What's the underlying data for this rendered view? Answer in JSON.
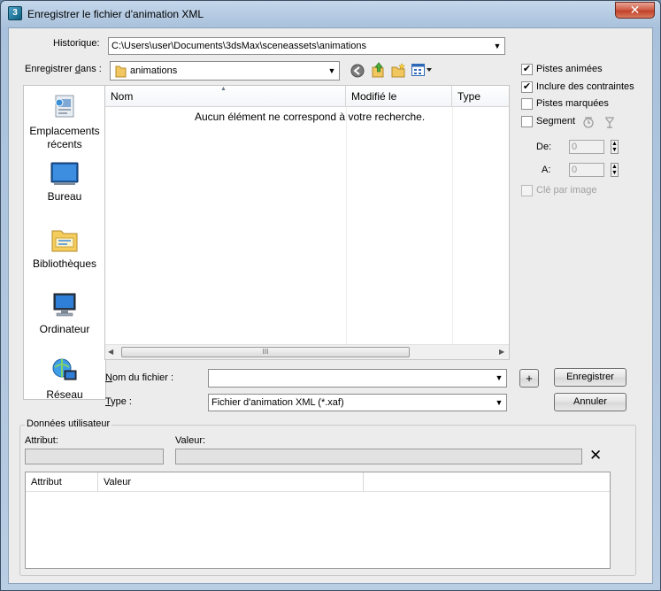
{
  "window": {
    "title": "Enregistrer le fichier d'animation XML",
    "close_symbol": "✕",
    "app_icon_symbol": "3"
  },
  "history": {
    "label": "Historique:",
    "value": "C:\\Users\\user\\Documents\\3dsMax\\sceneassets\\animations"
  },
  "save_in": {
    "label_pre": "Enregistrer ",
    "label_ul": "d",
    "label_post": "ans :",
    "value": "animations"
  },
  "places": [
    {
      "name": "recent",
      "label": "Emplacements récents"
    },
    {
      "name": "desktop",
      "label": "Bureau"
    },
    {
      "name": "libraries",
      "label": "Bibliothèques"
    },
    {
      "name": "computer",
      "label": "Ordinateur"
    },
    {
      "name": "network",
      "label": "Réseau"
    }
  ],
  "filelist": {
    "columns": [
      "Nom",
      "Modifié le",
      "Type"
    ],
    "empty_message": "Aucun élément ne correspond à votre recherche.",
    "scroll_grip": "III"
  },
  "filename": {
    "label_ul": "N",
    "label_post": "om du fichier :",
    "value": ""
  },
  "type": {
    "label_ul": "T",
    "label_post": "ype :",
    "value": "Fichier d'animation XML (*.xaf)"
  },
  "buttons": {
    "plus": "+",
    "save": "Enregistrer",
    "cancel": "Annuler"
  },
  "options": {
    "animated_tracks": {
      "label": "Pistes animées",
      "checked": true
    },
    "include_constraints": {
      "label": "Inclure des contraintes",
      "checked": true
    },
    "marked_tracks": {
      "label": "Pistes marquées",
      "checked": false
    },
    "segment": {
      "label": "Segment",
      "checked": false
    },
    "from": {
      "label": "De:",
      "value": "0"
    },
    "to": {
      "label": "A:",
      "value": "0"
    },
    "key_per_frame": {
      "label": "Clé par image",
      "checked": false,
      "disabled": true
    }
  },
  "user_data": {
    "group_title": "Données utilisateur",
    "attribute_label": "Attribut:",
    "value_label": "Valeur:",
    "delete_symbol": "✕",
    "columns": [
      "Attribut",
      "Valeur"
    ]
  }
}
